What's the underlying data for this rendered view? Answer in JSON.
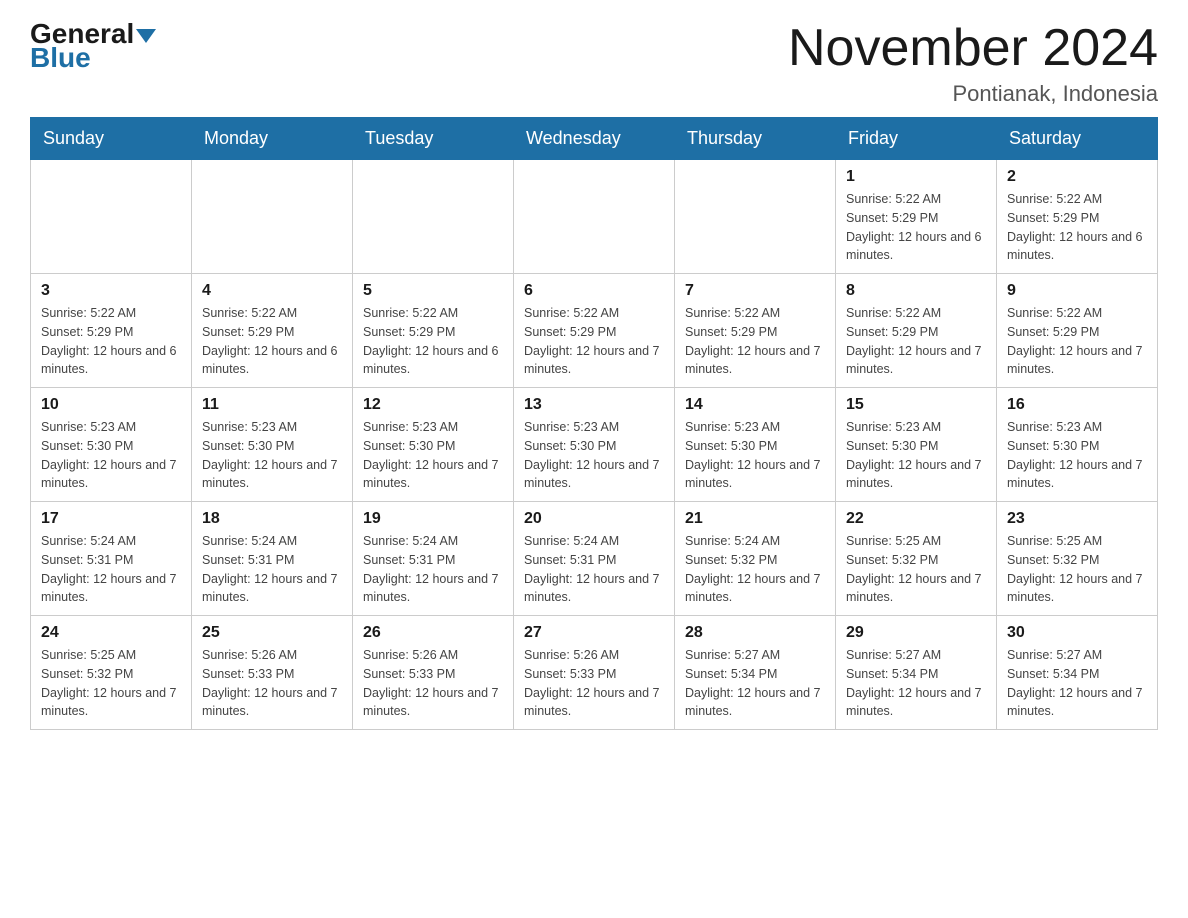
{
  "logo": {
    "general": "General",
    "blue": "Blue"
  },
  "title": "November 2024",
  "location": "Pontianak, Indonesia",
  "days_of_week": [
    "Sunday",
    "Monday",
    "Tuesday",
    "Wednesday",
    "Thursday",
    "Friday",
    "Saturday"
  ],
  "weeks": [
    [
      {
        "day": "",
        "info": ""
      },
      {
        "day": "",
        "info": ""
      },
      {
        "day": "",
        "info": ""
      },
      {
        "day": "",
        "info": ""
      },
      {
        "day": "",
        "info": ""
      },
      {
        "day": "1",
        "info": "Sunrise: 5:22 AM\nSunset: 5:29 PM\nDaylight: 12 hours and 6 minutes."
      },
      {
        "day": "2",
        "info": "Sunrise: 5:22 AM\nSunset: 5:29 PM\nDaylight: 12 hours and 6 minutes."
      }
    ],
    [
      {
        "day": "3",
        "info": "Sunrise: 5:22 AM\nSunset: 5:29 PM\nDaylight: 12 hours and 6 minutes."
      },
      {
        "day": "4",
        "info": "Sunrise: 5:22 AM\nSunset: 5:29 PM\nDaylight: 12 hours and 6 minutes."
      },
      {
        "day": "5",
        "info": "Sunrise: 5:22 AM\nSunset: 5:29 PM\nDaylight: 12 hours and 6 minutes."
      },
      {
        "day": "6",
        "info": "Sunrise: 5:22 AM\nSunset: 5:29 PM\nDaylight: 12 hours and 7 minutes."
      },
      {
        "day": "7",
        "info": "Sunrise: 5:22 AM\nSunset: 5:29 PM\nDaylight: 12 hours and 7 minutes."
      },
      {
        "day": "8",
        "info": "Sunrise: 5:22 AM\nSunset: 5:29 PM\nDaylight: 12 hours and 7 minutes."
      },
      {
        "day": "9",
        "info": "Sunrise: 5:22 AM\nSunset: 5:29 PM\nDaylight: 12 hours and 7 minutes."
      }
    ],
    [
      {
        "day": "10",
        "info": "Sunrise: 5:23 AM\nSunset: 5:30 PM\nDaylight: 12 hours and 7 minutes."
      },
      {
        "day": "11",
        "info": "Sunrise: 5:23 AM\nSunset: 5:30 PM\nDaylight: 12 hours and 7 minutes."
      },
      {
        "day": "12",
        "info": "Sunrise: 5:23 AM\nSunset: 5:30 PM\nDaylight: 12 hours and 7 minutes."
      },
      {
        "day": "13",
        "info": "Sunrise: 5:23 AM\nSunset: 5:30 PM\nDaylight: 12 hours and 7 minutes."
      },
      {
        "day": "14",
        "info": "Sunrise: 5:23 AM\nSunset: 5:30 PM\nDaylight: 12 hours and 7 minutes."
      },
      {
        "day": "15",
        "info": "Sunrise: 5:23 AM\nSunset: 5:30 PM\nDaylight: 12 hours and 7 minutes."
      },
      {
        "day": "16",
        "info": "Sunrise: 5:23 AM\nSunset: 5:30 PM\nDaylight: 12 hours and 7 minutes."
      }
    ],
    [
      {
        "day": "17",
        "info": "Sunrise: 5:24 AM\nSunset: 5:31 PM\nDaylight: 12 hours and 7 minutes."
      },
      {
        "day": "18",
        "info": "Sunrise: 5:24 AM\nSunset: 5:31 PM\nDaylight: 12 hours and 7 minutes."
      },
      {
        "day": "19",
        "info": "Sunrise: 5:24 AM\nSunset: 5:31 PM\nDaylight: 12 hours and 7 minutes."
      },
      {
        "day": "20",
        "info": "Sunrise: 5:24 AM\nSunset: 5:31 PM\nDaylight: 12 hours and 7 minutes."
      },
      {
        "day": "21",
        "info": "Sunrise: 5:24 AM\nSunset: 5:32 PM\nDaylight: 12 hours and 7 minutes."
      },
      {
        "day": "22",
        "info": "Sunrise: 5:25 AM\nSunset: 5:32 PM\nDaylight: 12 hours and 7 minutes."
      },
      {
        "day": "23",
        "info": "Sunrise: 5:25 AM\nSunset: 5:32 PM\nDaylight: 12 hours and 7 minutes."
      }
    ],
    [
      {
        "day": "24",
        "info": "Sunrise: 5:25 AM\nSunset: 5:32 PM\nDaylight: 12 hours and 7 minutes."
      },
      {
        "day": "25",
        "info": "Sunrise: 5:26 AM\nSunset: 5:33 PM\nDaylight: 12 hours and 7 minutes."
      },
      {
        "day": "26",
        "info": "Sunrise: 5:26 AM\nSunset: 5:33 PM\nDaylight: 12 hours and 7 minutes."
      },
      {
        "day": "27",
        "info": "Sunrise: 5:26 AM\nSunset: 5:33 PM\nDaylight: 12 hours and 7 minutes."
      },
      {
        "day": "28",
        "info": "Sunrise: 5:27 AM\nSunset: 5:34 PM\nDaylight: 12 hours and 7 minutes."
      },
      {
        "day": "29",
        "info": "Sunrise: 5:27 AM\nSunset: 5:34 PM\nDaylight: 12 hours and 7 minutes."
      },
      {
        "day": "30",
        "info": "Sunrise: 5:27 AM\nSunset: 5:34 PM\nDaylight: 12 hours and 7 minutes."
      }
    ]
  ]
}
